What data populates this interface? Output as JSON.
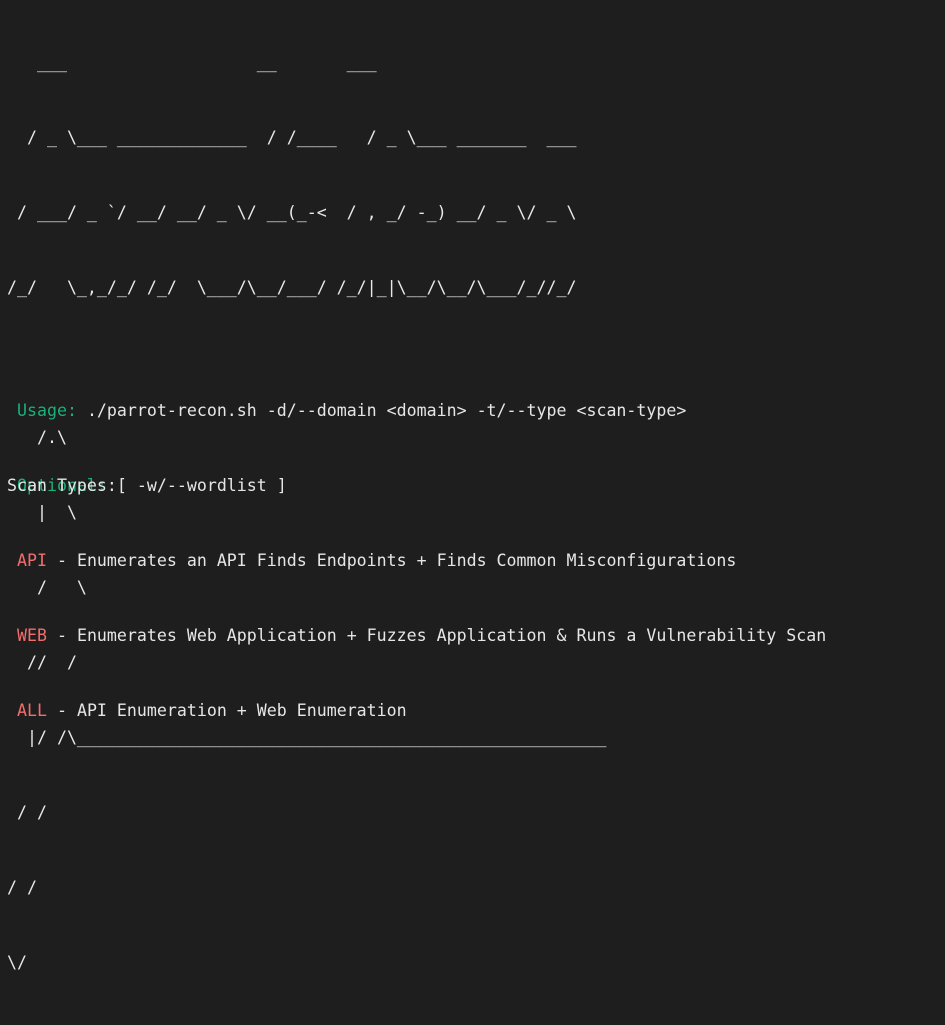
{
  "terminal": {
    "banner_lines": [
      "   ___                   __       ___",
      "  / _ \\___ _____________  / /____   / _ \\___ _______  ___",
      " / ___/ _ `/ __/ __/ _ \\/ __(_-<  / , _/ -_) __/ _ \\/ _ \\",
      "/_/   \\_,_/_/ /_/  \\___/\\__/___/ /_/|_|\\__/\\__/\\___/_//_/",
      "",
      "   /.\\",
      "   |  \\",
      "   /   \\",
      "  //  /",
      "  |/ /\\_____________________________________________________",
      " / /",
      "/ /",
      "\\/"
    ],
    "usage": {
      "label": "Usage:",
      "text": " ./parrot-recon.sh -d/--domain <domain> -t/--type <scan-type>"
    },
    "optional": {
      "label": "Optional:",
      "text": " [ -w/--wordlist ]"
    },
    "scan_types_heading": "Scan Types:",
    "scan_types": [
      {
        "name": "API",
        "description": " - Enumerates an API Finds Endpoints + Finds Common Misconfigurations"
      },
      {
        "name": "WEB",
        "description": " - Enumerates Web Application + Fuzzes Application & Runs a Vulnerability Scan"
      },
      {
        "name": "ALL",
        "description": " - API Enumeration + Web Enumeration"
      }
    ],
    "colors": {
      "background": "#1e1e1e",
      "foreground": "#e6e6e6",
      "label_green": "#19b07a",
      "scan_type_red": "#f26d6d"
    }
  }
}
